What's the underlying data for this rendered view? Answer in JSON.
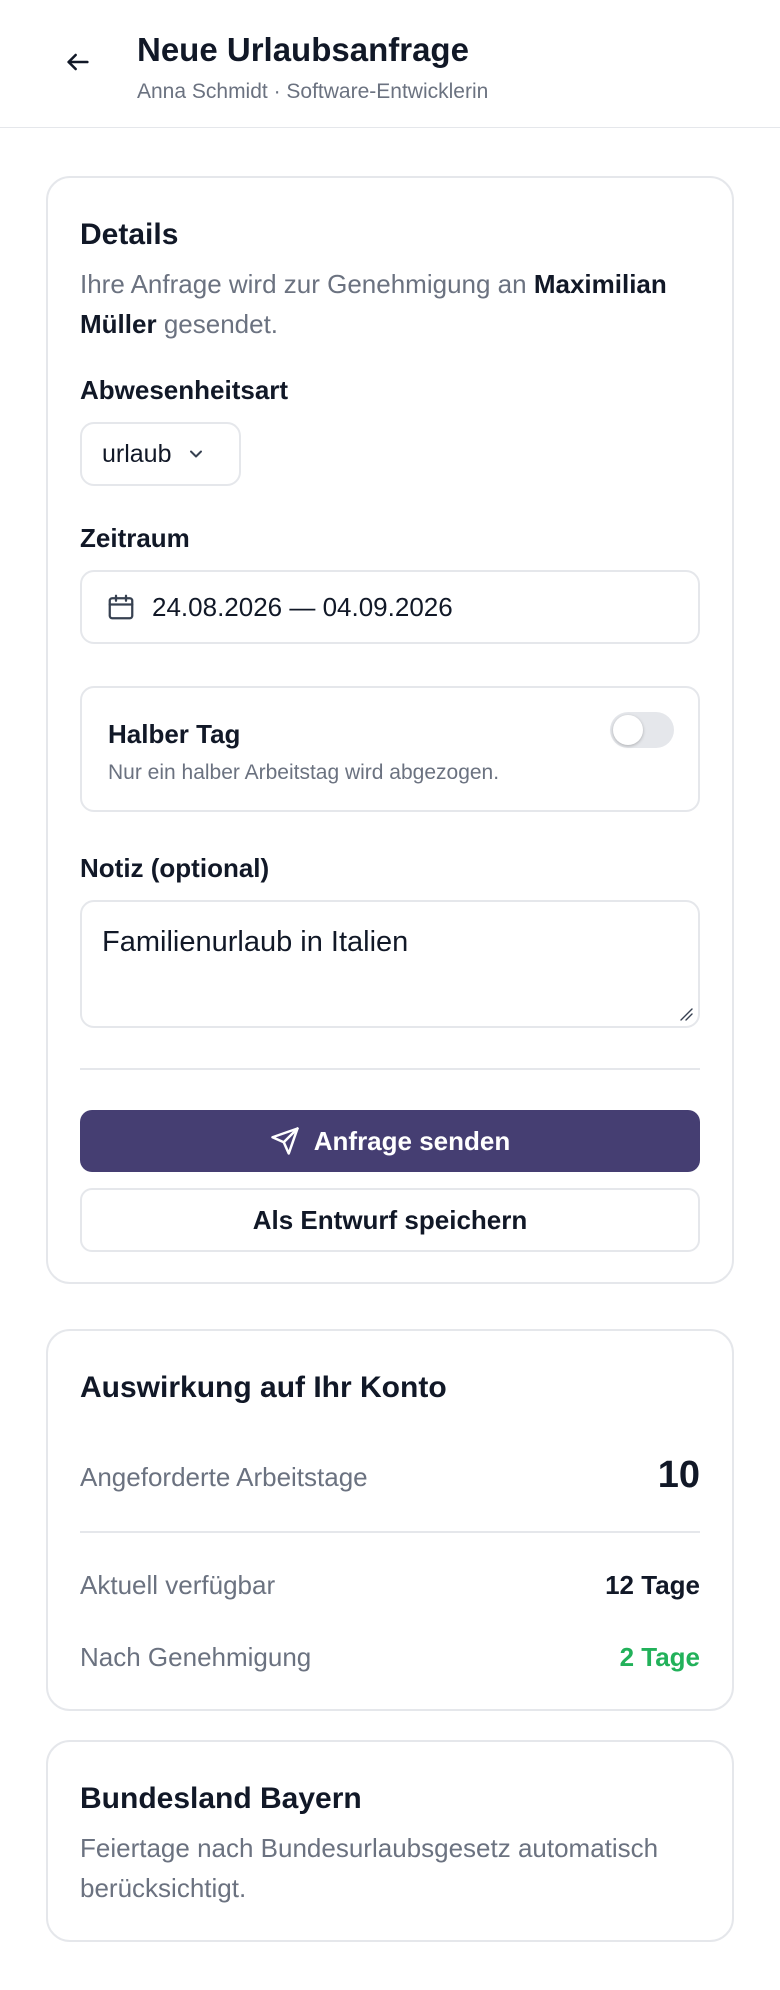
{
  "header": {
    "title": "Neue Urlaubsanfrage",
    "subtitle": "Anna Schmidt · Software-Entwicklerin"
  },
  "details": {
    "title": "Details",
    "intro_prefix": "Ihre Anfrage wird zur Genehmigung an",
    "approver": "Maximilian Müller",
    "intro_suffix": "gesendet.",
    "absence_label": "Abwesenheitsart",
    "absence_value": "urlaub",
    "period_label": "Zeitraum",
    "period_value": "24.08.2026 — 04.09.2026",
    "halfday_title": "Halber Tag",
    "halfday_desc": "Nur ein halber Arbeitstag wird abgezogen.",
    "halfday_on": false,
    "note_label": "Notiz (optional)",
    "note_value": "Familienurlaub in Italien",
    "submit_label": "Anfrage senden",
    "draft_label": "Als Entwurf speichern"
  },
  "impact": {
    "title": "Auswirkung auf Ihr Konto",
    "requested_label": "Angeforderte Arbeitstage",
    "requested_value": "10",
    "available_label": "Aktuell verfügbar",
    "available_value": "12 Tage",
    "after_label": "Nach Genehmigung",
    "after_value": "2 Tage"
  },
  "region": {
    "title": "Bundesland Bayern",
    "desc": "Feiertage nach Bundesurlaubsgesetz automatisch berücksichtigt."
  },
  "colors": {
    "primary": "#453e72",
    "positive": "#22b15a",
    "border": "#e5e7eb",
    "muted": "#6b7280"
  }
}
